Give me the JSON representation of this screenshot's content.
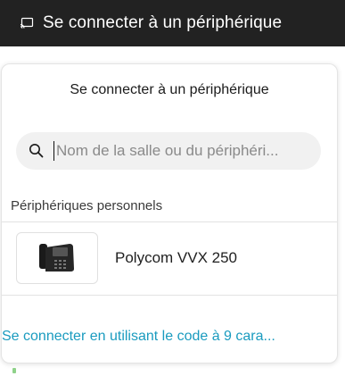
{
  "header": {
    "icon": "cast-screen-icon",
    "title": "Se connecter à un périphérique"
  },
  "popup": {
    "title": "Se connecter à un périphérique",
    "search": {
      "icon": "search-icon",
      "value": "",
      "placeholder": "Nom de la salle ou du périphéri..."
    },
    "section_label": "Périphériques personnels",
    "devices": [
      {
        "name": "Polycom VVX 250",
        "icon": "desk-phone-icon"
      }
    ],
    "code_link": "Se connecter en utilisant le code à 9 cara..."
  },
  "colors": {
    "header_bg": "#222222",
    "link": "#1a9bbf"
  }
}
